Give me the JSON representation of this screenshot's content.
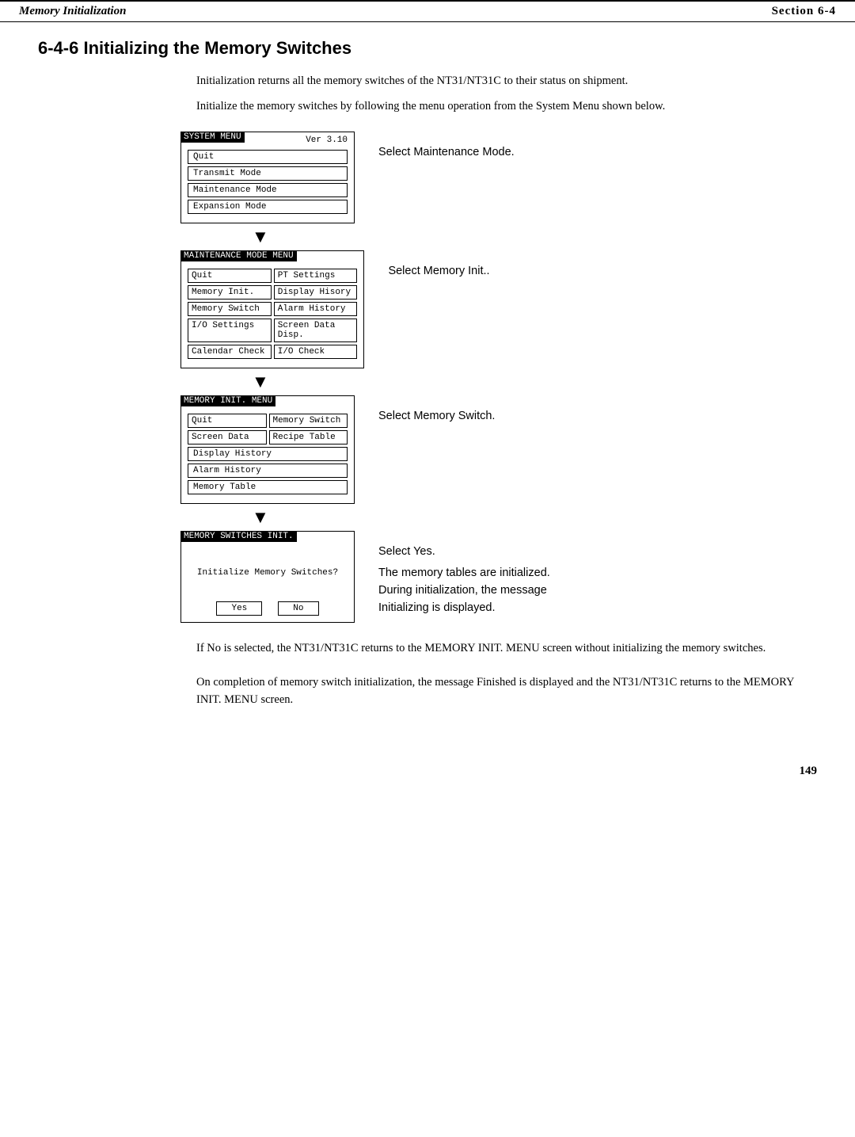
{
  "header": {
    "left": "Memory Initialization",
    "right": "Section   6-4"
  },
  "section_title": "6-4-6  Initializing the Memory Switches",
  "intro": [
    "Initialization returns all the memory switches of the NT31/NT31C to their status on shipment.",
    "Initialize the memory switches by following the menu operation from the System Menu shown below."
  ],
  "menus": [
    {
      "id": "system-menu",
      "title": "SYSTEM MENU",
      "ver": "Ver 3.10",
      "buttons_single": [
        "Quit",
        "Transmit Mode",
        "Maintenance Mode",
        "Expansion Mode"
      ],
      "buttons_double": [],
      "side_label": "Select Maintenance Mode."
    },
    {
      "id": "maintenance-menu",
      "title": "MAINTENANCE MODE MENU",
      "buttons_double": [
        [
          "Quit",
          "PT Settings"
        ],
        [
          "Memory Init.",
          "Display Hisory"
        ],
        [
          "Memory Switch",
          "Alarm History"
        ],
        [
          "I/O Settings",
          "Screen Data Disp."
        ],
        [
          "Calendar Check",
          "I/O Check"
        ]
      ],
      "side_label": "Select Memory Init.."
    },
    {
      "id": "memory-init-menu",
      "title": "MEMORY INIT. MENU",
      "buttons_double": [
        [
          "Quit",
          "Memory Switch"
        ],
        [
          "Screen Data",
          "Recipe Table"
        ]
      ],
      "buttons_single": [
        "Display History",
        "Alarm History",
        "Memory Table"
      ],
      "side_label": "Select Memory Switch."
    },
    {
      "id": "memory-switches-init",
      "title": "MEMORY SWITCHES INIT.",
      "init_message": "Initialize Memory Switches?",
      "yes_label": "Yes",
      "no_label": "No",
      "side_label_line1": "Select Yes.",
      "side_label_line2": "The memory tables are initialized. During initialization, the message Initializing is displayed."
    }
  ],
  "bottom_texts": [
    "If No is selected, the NT31/NT31C returns to the MEMORY INIT. MENU screen without initializing the memory switches.",
    "On completion of memory switch initialization, the message Finished is displayed and the NT31/NT31C returns to the MEMORY INIT. MENU screen."
  ],
  "page_number": "149"
}
